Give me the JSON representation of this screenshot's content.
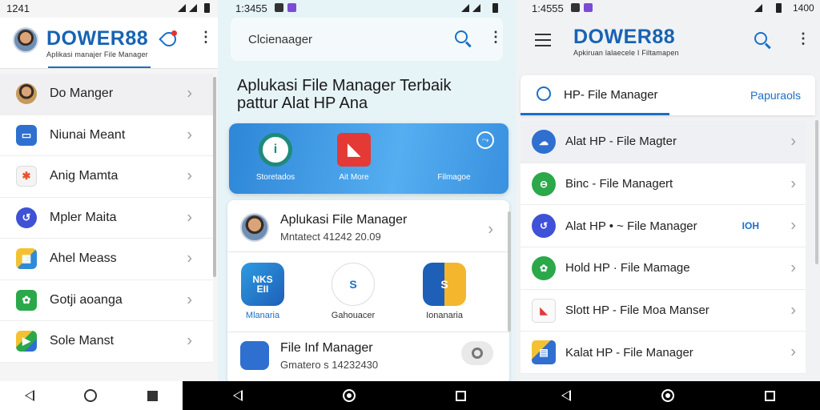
{
  "screen1": {
    "status_time": "1241",
    "brand_main": "DOWER",
    "brand_num": "88",
    "brand_tagline": "Aplikasi manajer File Manager",
    "items": [
      {
        "label": "Do Manger",
        "icon": "avatar-icon",
        "color": "#c59a5a"
      },
      {
        "label": "Niunai Meant",
        "icon": "window-icon",
        "color": "#2f6fd0"
      },
      {
        "label": "Anig Mamta",
        "icon": "star-icon",
        "color": "#f0f0f0"
      },
      {
        "label": "Mpler Maita",
        "icon": "swirl-icon",
        "color": "#3f51d6"
      },
      {
        "label": "Ahel Meass",
        "icon": "puzzle-icon",
        "color": "#2f8ad8"
      },
      {
        "label": "Gotji aoanga",
        "icon": "gear-icon",
        "color": "#2aa84a"
      },
      {
        "label": "Sole Manst",
        "icon": "play-icon",
        "color": "#f3c233"
      }
    ]
  },
  "screen2": {
    "status_time": "1:3455",
    "search_placeholder": "Clcienaager",
    "heading_line1": "Aplukasi File Manager Terbaik",
    "heading_line2": "pattur  Alat HP Ana",
    "promo_items": [
      {
        "label": "Storetados",
        "icon": "clock-icon"
      },
      {
        "label": "Ait More",
        "icon": "folder-icon"
      },
      {
        "label": "Filmagoe",
        "icon": "share-icon"
      }
    ],
    "card_title": "Aplukasi File Manager",
    "card_subtitle": "Mntatect 41242 20.09",
    "apps": [
      {
        "label": "Mlanaria",
        "text": "NKS\nEII"
      },
      {
        "label": "Gahouacer",
        "text": "S"
      },
      {
        "label": "Ionanaria",
        "text": "S"
      }
    ],
    "fm_title": "File Inf Manager",
    "fm_subtitle": "Gmatero s 14232430"
  },
  "screen3": {
    "status_time": "1:4555",
    "status_time_right": "1400",
    "brand_main": "DOWER",
    "brand_num": "88",
    "brand_tagline": "Apkiruan lalaecele I Filtamapen",
    "tab_active": "HP- File Manager",
    "tab_other": "Papuraols",
    "items": [
      {
        "label": "Alat HP - File Magter",
        "color": "#2f6fd0",
        "badge": ""
      },
      {
        "label": "Binc - File Managert",
        "color": "#2aa84a",
        "badge": ""
      },
      {
        "label": "Alat HP • ~ File Manager",
        "color": "#3f51d6",
        "badge": "IOH"
      },
      {
        "label": "Hold HP · File Mamage",
        "color": "#2aa84a",
        "badge": ""
      },
      {
        "label": "Slott HP  - File Moa Manser",
        "color": "#f2f2f2",
        "badge": ""
      },
      {
        "label": "Kalat HP - File Manager",
        "color": "#2f6fd0",
        "badge": ""
      }
    ]
  }
}
